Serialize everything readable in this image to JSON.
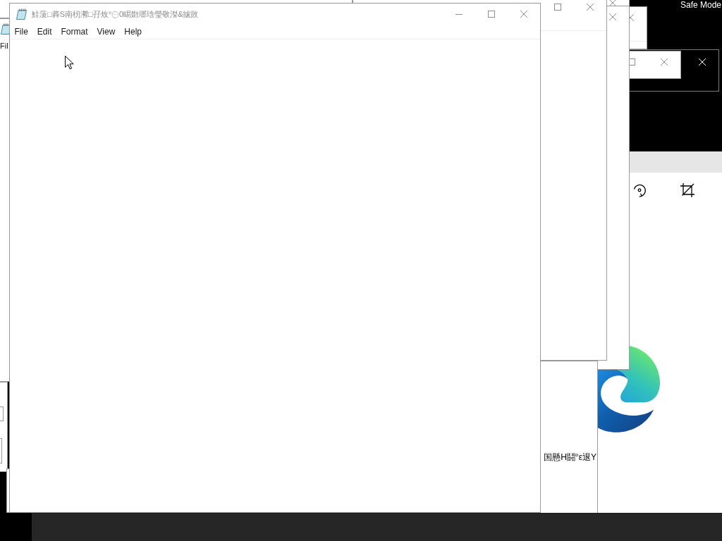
{
  "desktop": {
    "mode_label": "Safe Mode"
  },
  "notepad": {
    "title": "鮭蔆□蕣S南杒灪□孖炇°㊀0睗敪瑯琀瑩敬滐&攄敳",
    "menu": [
      {
        "label": "File"
      },
      {
        "label": "Edit"
      },
      {
        "label": "Format"
      },
      {
        "label": "View"
      },
      {
        "label": "Help"
      }
    ]
  },
  "back_notepad": {
    "menu_fragment": "Fil"
  },
  "back_window": {
    "text": "国懸H鬪°ε退Y"
  }
}
